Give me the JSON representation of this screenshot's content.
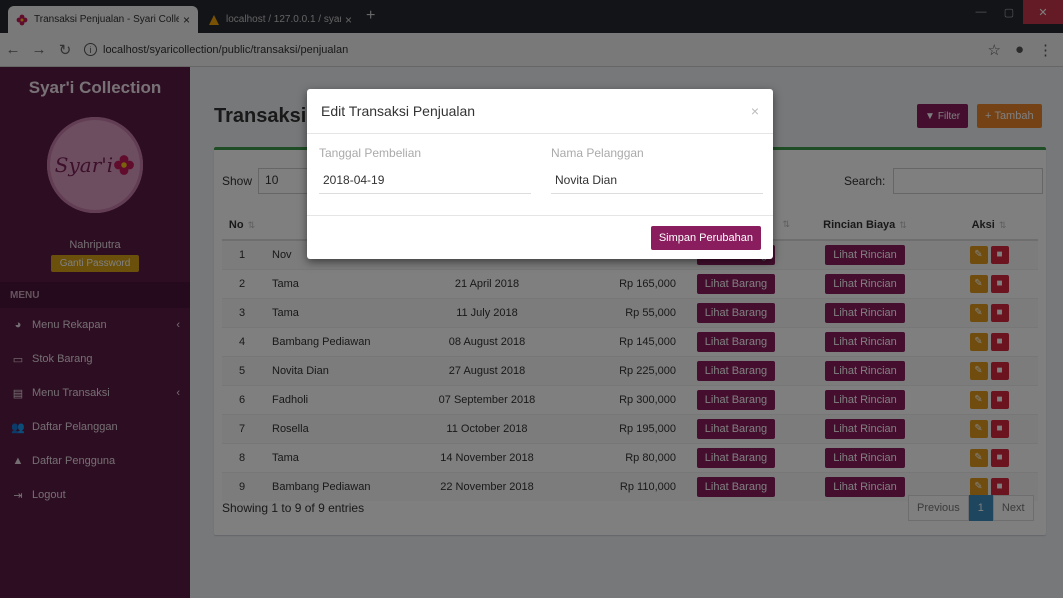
{
  "browser": {
    "tabs": [
      {
        "title": "Transaksi Penjualan - Syari Colle",
        "close": "×"
      },
      {
        "title": "localhost / 127.0.0.1 / syaricollect",
        "close": "×"
      }
    ],
    "new_tab": "+",
    "url": "localhost/syaricollection/public/transaksi/penjualan"
  },
  "sidebar": {
    "brand": "Syar'i Collection",
    "logo_text": "Syar'i",
    "user_name": "Nahriputra",
    "password_button": "Ganti Password",
    "menu_header": "MENU",
    "items": [
      {
        "label": "Menu Rekapan",
        "icon": "pie-chart-icon",
        "has_submenu": true
      },
      {
        "label": "Stok Barang",
        "icon": "laptop-icon",
        "has_submenu": false
      },
      {
        "label": "Menu Transaksi",
        "icon": "file-icon",
        "has_submenu": true
      },
      {
        "label": "Daftar Pelanggan",
        "icon": "users-icon",
        "has_submenu": false
      },
      {
        "label": "Daftar Pengguna",
        "icon": "user-icon",
        "has_submenu": false
      },
      {
        "label": "Logout",
        "icon": "sign-out-icon",
        "has_submenu": false
      }
    ]
  },
  "main": {
    "title": "Transaksi",
    "filter_button": "Filter",
    "add_button": "Tambah",
    "show_label": "Show",
    "show_value": "10",
    "search_label": "Search:",
    "columns": [
      "No",
      "Rincian Biaya",
      "Aksi"
    ],
    "barang_button": "Lihat Barang",
    "rincian_button": "Lihat Rincian",
    "rows": [
      {
        "no": "1",
        "nama": "Nov",
        "tanggal": "",
        "total": ""
      },
      {
        "no": "2",
        "nama": "Tama",
        "tanggal": "21 April 2018",
        "total": "Rp 165,000"
      },
      {
        "no": "3",
        "nama": "Tama",
        "tanggal": "11 July 2018",
        "total": "Rp 55,000"
      },
      {
        "no": "4",
        "nama": "Bambang Pediawan",
        "tanggal": "08 August 2018",
        "total": "Rp 145,000"
      },
      {
        "no": "5",
        "nama": "Novita Dian",
        "tanggal": "27 August 2018",
        "total": "Rp 225,000"
      },
      {
        "no": "6",
        "nama": "Fadholi",
        "tanggal": "07 September 2018",
        "total": "Rp 300,000"
      },
      {
        "no": "7",
        "nama": "Rosella",
        "tanggal": "11 October 2018",
        "total": "Rp 195,000"
      },
      {
        "no": "8",
        "nama": "Tama",
        "tanggal": "14 November 2018",
        "total": "Rp 80,000"
      },
      {
        "no": "9",
        "nama": "Bambang Pediawan",
        "tanggal": "22 November 2018",
        "total": "Rp 110,000"
      }
    ],
    "info": "Showing 1 to 9 of 9 entries",
    "pager": {
      "previous": "Previous",
      "current": "1",
      "next": "Next"
    }
  },
  "modal": {
    "title": "Edit Transaksi Penjualan",
    "close": "×",
    "date_label": "Tanggal Pembelian",
    "date_value": "2018-04-19",
    "customer_label": "Nama Pelanggan",
    "customer_value": "Novita Dian",
    "save_button": "Simpan Perubahan"
  },
  "colors": {
    "sidebar": "#5b1b45",
    "accent_purple": "#8a1d5e",
    "accent_orange": "#e8842a",
    "box_border": "#3e9a4a"
  }
}
